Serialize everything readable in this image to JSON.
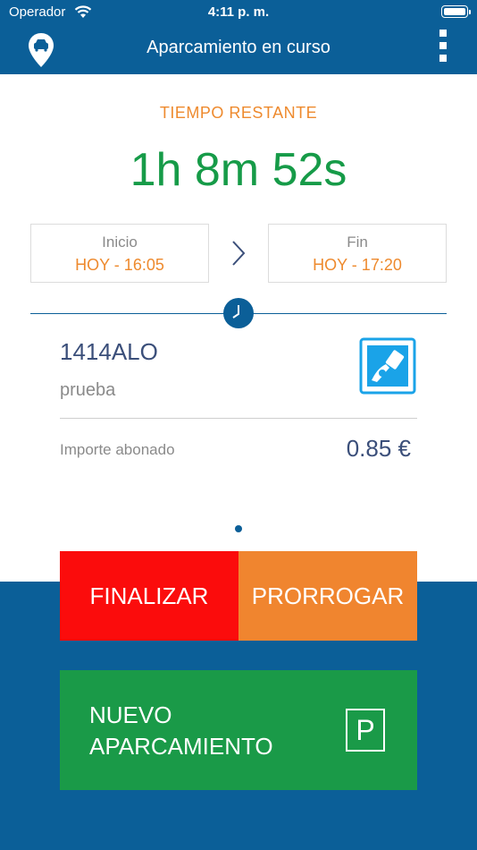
{
  "status_bar": {
    "carrier": "Operador",
    "time": "4:11 p. m."
  },
  "header": {
    "title": "Aparcamiento en curso"
  },
  "timer": {
    "label": "TIEMPO RESTANTE",
    "value": "1h 8m 52s"
  },
  "start": {
    "label": "Inicio",
    "value": "HOY - 16:05"
  },
  "end": {
    "label": "Fin",
    "value": "HOY - 17:20"
  },
  "vehicle": {
    "plate": "1414ALO",
    "description": "prueba"
  },
  "payment": {
    "label": "Importe abonado",
    "amount": "0.85 €"
  },
  "actions": {
    "finish": "FINALIZAR",
    "extend": "PRORROGAR",
    "new_line1": "NUEVO",
    "new_line2": "APARCAMIENTO",
    "parking_symbol": "P"
  },
  "colors": {
    "brand_blue": "#0b5f98",
    "orange": "#ee8a2e",
    "green": "#169b48",
    "red": "#fb0c0c"
  }
}
